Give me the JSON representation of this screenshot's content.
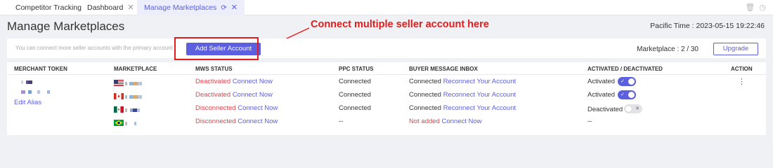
{
  "tabs": [
    {
      "label": "Competitor Tracking"
    },
    {
      "label": "Dashboard"
    },
    {
      "label": "Manage Marketplaces"
    }
  ],
  "page": {
    "title": "Manage Marketplaces",
    "pacific_time_label": "Pacific Time :",
    "pacific_time_value": "2023-05-15 19:22:46"
  },
  "topbar": {
    "hint": "You can connect more seller accounts with the primary account",
    "add_button": "Add Seller Account",
    "marketplace_count": "Marketplace : 2 / 30",
    "upgrade_button": "Upgrade"
  },
  "annotation": {
    "text": "Connect multiple seller account here",
    "color": "#e21b1b"
  },
  "colors": {
    "accent": "#5b5fe0",
    "error": "#e0434c"
  },
  "table": {
    "headers": [
      "MERCHANT TOKEN",
      "MARKETPLACE",
      "MWS STATUS",
      "PPC STATUS",
      "BUYER MESSAGE INBOX",
      "ACTIVATED / DEACTIVATED",
      "ACTION"
    ],
    "edit_alias": "Edit Alias",
    "action_icon": "more-vertical-icon",
    "rows": [
      {
        "flag": "us-flag-icon",
        "mws_status": "Deactivated",
        "mws_action": "Connect Now",
        "ppc_status": "Connected",
        "inbox_status": "Connected",
        "inbox_action": "Reconnect Your Account",
        "active_label": "Activated",
        "active": true
      },
      {
        "flag": "ca-flag-icon",
        "mws_status": "Deactivated",
        "mws_action": "Connect Now",
        "ppc_status": "Connected",
        "inbox_status": "Connected",
        "inbox_action": "Reconnect Your Account",
        "active_label": "Activated",
        "active": true
      },
      {
        "flag": "mx-flag-icon",
        "mws_status": "Disconnected",
        "mws_action": "Connect Now",
        "ppc_status": "Connected",
        "inbox_status": "Connected",
        "inbox_action": "Reconnect Your Account",
        "active_label": "Deactivated",
        "active": false
      },
      {
        "flag": "br-flag-icon",
        "mws_status": "Disconnected",
        "mws_action": "Connect Now",
        "ppc_status": "--",
        "inbox_status": "Not added",
        "inbox_action": "Connect Now",
        "active_label": "--",
        "active": null
      }
    ]
  }
}
